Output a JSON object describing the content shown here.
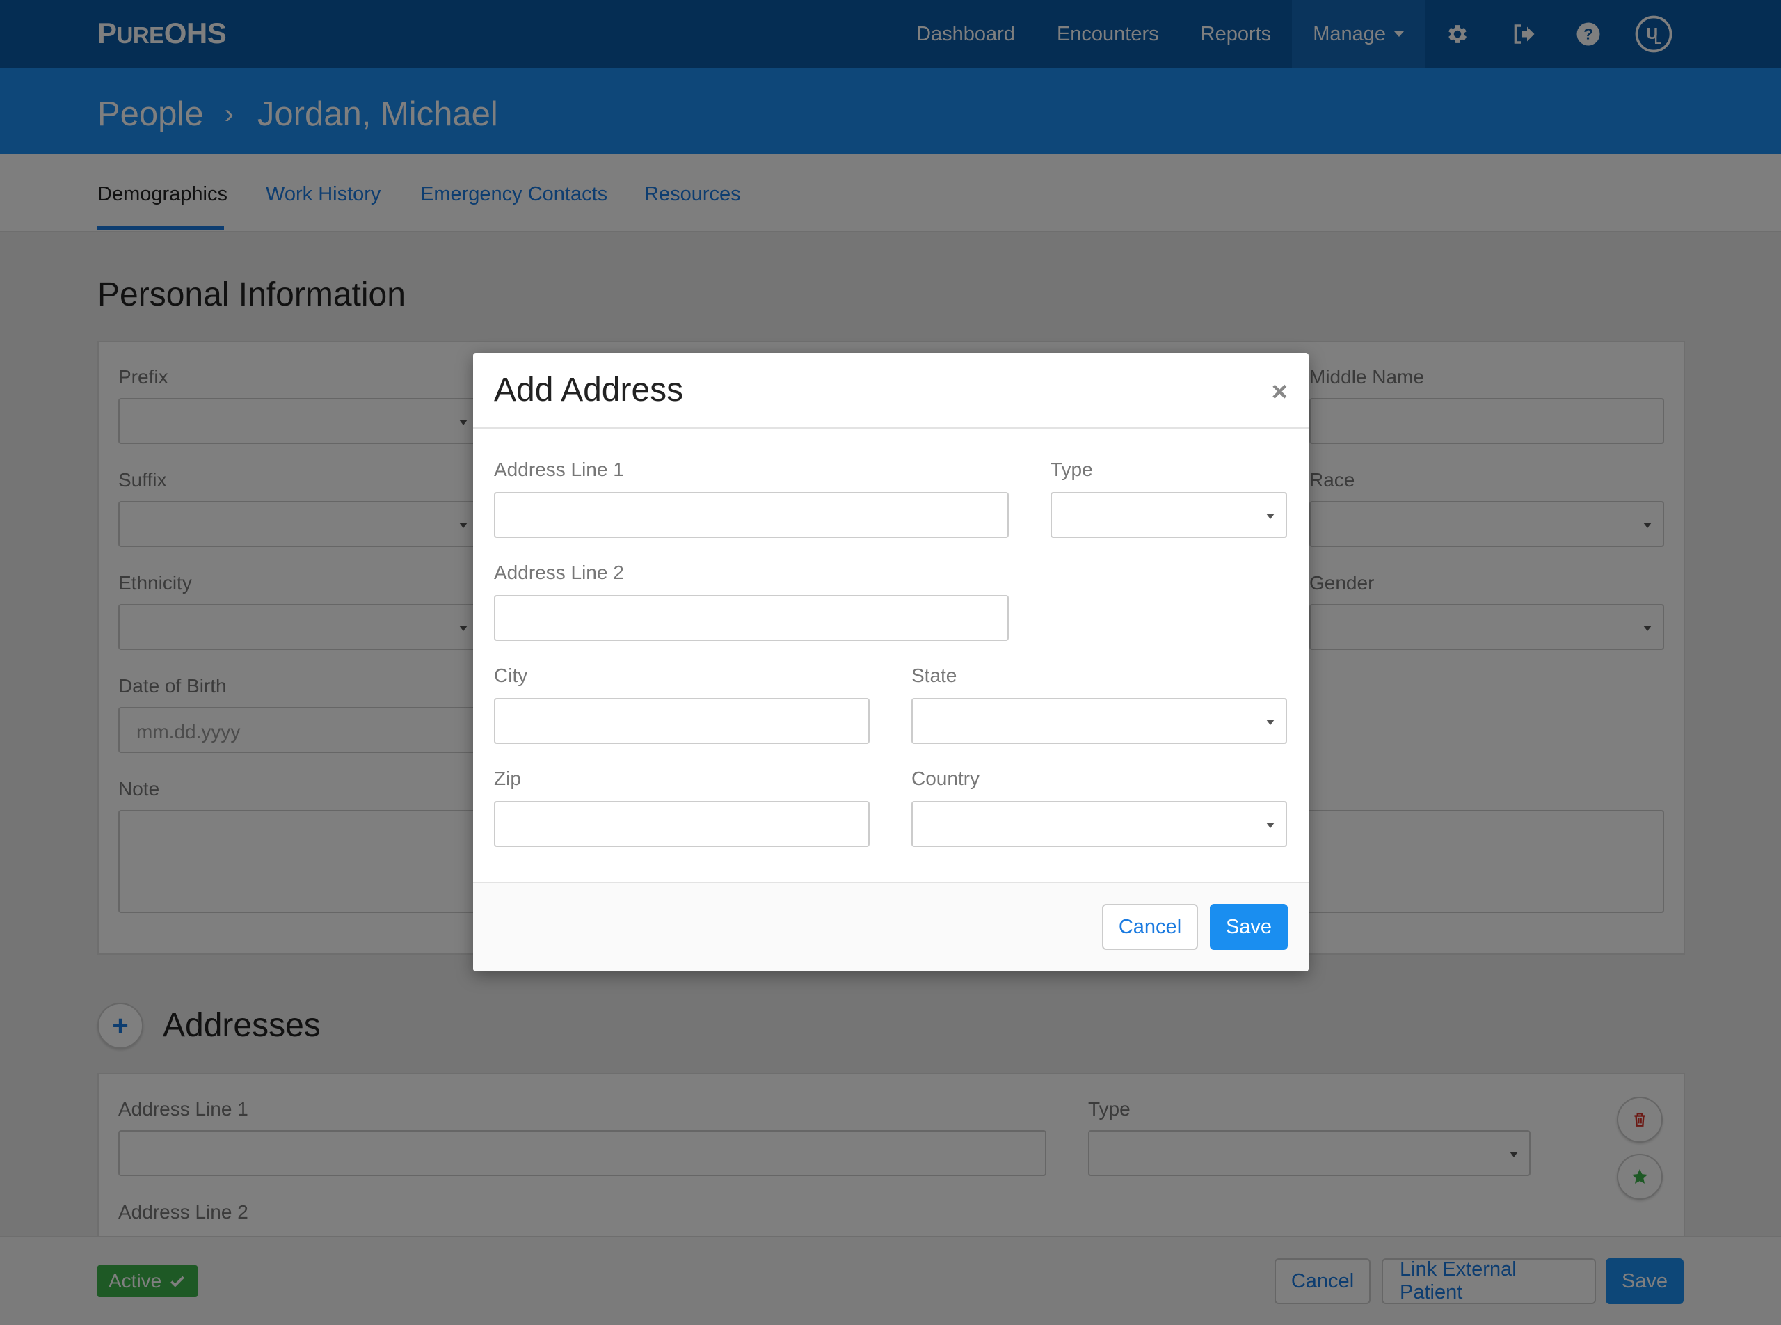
{
  "app": {
    "logo_first": "P",
    "logo_small": "URE",
    "logo_rest": "OHS"
  },
  "nav": {
    "dashboard": "Dashboard",
    "encounters": "Encounters",
    "reports": "Reports",
    "manage": "Manage",
    "icons": [
      "gear-icon",
      "sign-out-icon",
      "help-icon",
      "ul-logo-icon"
    ]
  },
  "breadcrumb": {
    "parent": "People",
    "separator": "›",
    "current": "Jordan, Michael"
  },
  "tabs": {
    "demographics": "Demographics",
    "work_history": "Work History",
    "emergency_contacts": "Emergency Contacts",
    "resources": "Resources"
  },
  "personal": {
    "title": "Personal Information",
    "prefix": "Prefix",
    "suffix": "Suffix",
    "ethnicity": "Ethnicity",
    "dob": "Date of Birth",
    "dob_placeholder": "mm.dd.yyyy",
    "note": "Note",
    "middle_name": "Middle Name",
    "race": "Race",
    "gender": "Gender"
  },
  "addresses": {
    "title": "Addresses",
    "add_symbol": "+",
    "line1": "Address Line 1",
    "type": "Type",
    "line2": "Address Line 2"
  },
  "bottom": {
    "status": "Active",
    "cancel": "Cancel",
    "link_external": "Link External Patient",
    "save": "Save"
  },
  "modal": {
    "title": "Add Address",
    "close": "×",
    "line1": "Address Line 1",
    "type": "Type",
    "line2": "Address Line 2",
    "city": "City",
    "state": "State",
    "zip": "Zip",
    "country": "Country",
    "cancel": "Cancel",
    "save": "Save"
  },
  "colors": {
    "nav_bg": "#0a5aa7",
    "crumb_bg": "#1d8ef2",
    "link": "#1a7ae0",
    "primary": "#1a8ef0",
    "success": "#3cb34a",
    "danger": "#d9342b"
  }
}
